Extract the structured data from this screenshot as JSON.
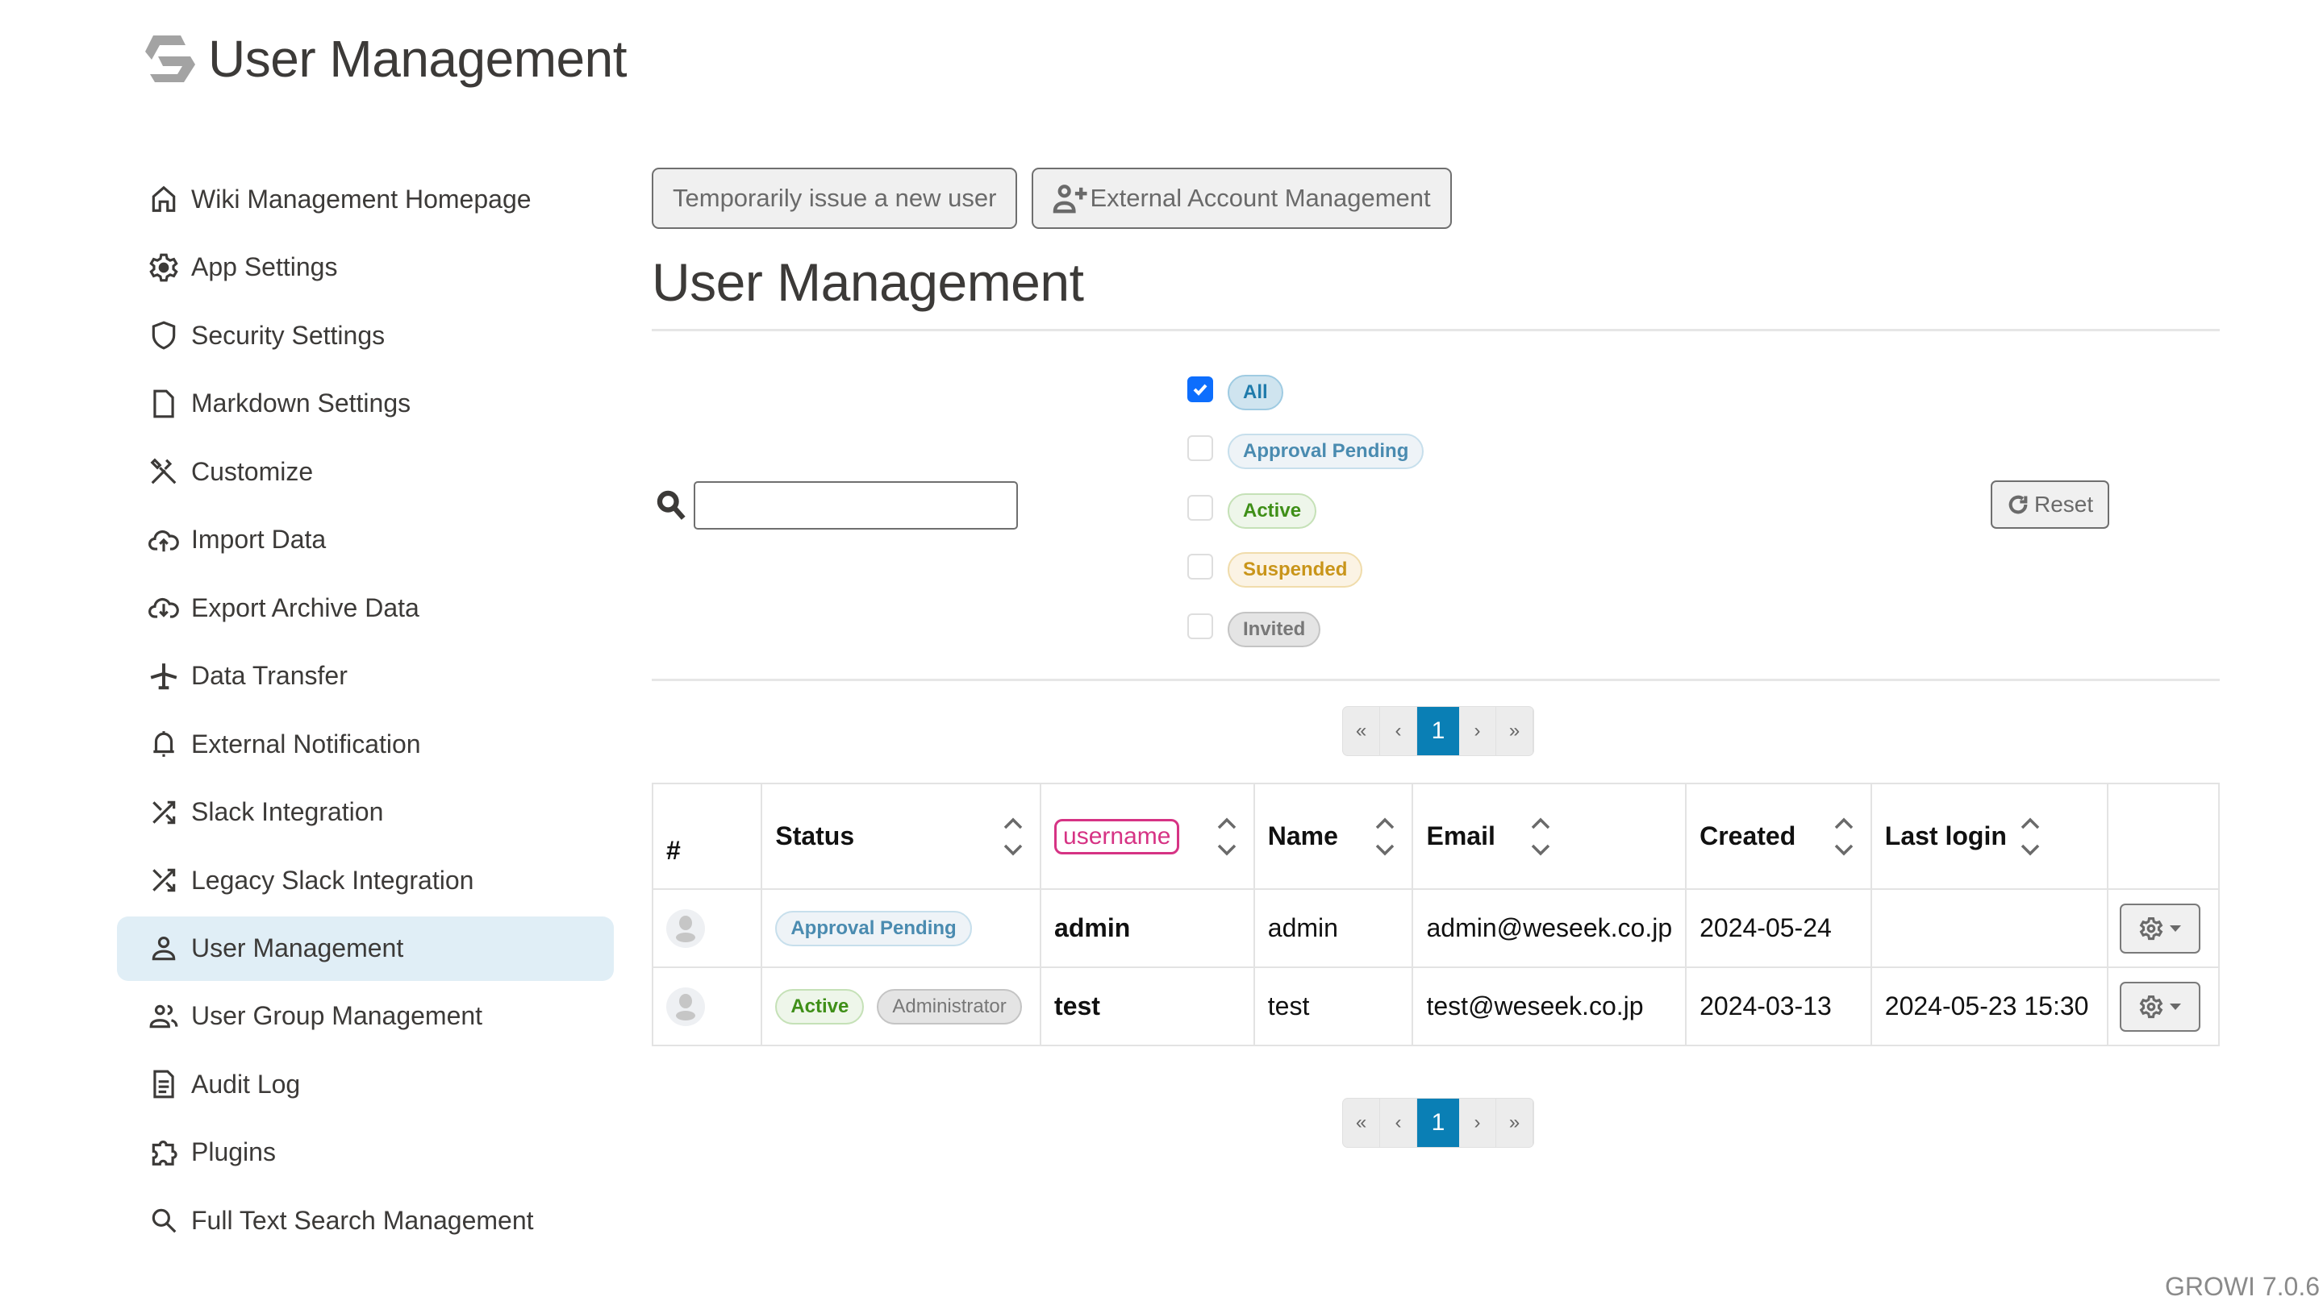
{
  "header": {
    "title": "User Management",
    "logo_icon": "growi-logo"
  },
  "sidebar": {
    "items": [
      {
        "label": "Wiki Management Homepage",
        "icon": "home-icon",
        "active": false
      },
      {
        "label": "App Settings",
        "icon": "gear-icon",
        "active": false
      },
      {
        "label": "Security Settings",
        "icon": "shield-icon",
        "active": false
      },
      {
        "label": "Markdown Settings",
        "icon": "file-icon",
        "active": false
      },
      {
        "label": "Customize",
        "icon": "tools-icon",
        "active": false
      },
      {
        "label": "Import Data",
        "icon": "cloud-upload-icon",
        "active": false
      },
      {
        "label": "Export Archive Data",
        "icon": "cloud-download-icon",
        "active": false
      },
      {
        "label": "Data Transfer",
        "icon": "airplane-icon",
        "active": false
      },
      {
        "label": "External Notification",
        "icon": "bell-icon",
        "active": false
      },
      {
        "label": "Slack Integration",
        "icon": "shuffle-icon",
        "active": false
      },
      {
        "label": "Legacy Slack Integration",
        "icon": "shuffle-icon",
        "active": false
      },
      {
        "label": "User Management",
        "icon": "person-icon",
        "active": true
      },
      {
        "label": "User Group Management",
        "icon": "people-icon",
        "active": false
      },
      {
        "label": "Audit Log",
        "icon": "document-icon",
        "active": false
      },
      {
        "label": "Plugins",
        "icon": "puzzle-icon",
        "active": false
      },
      {
        "label": "Full Text Search Management",
        "icon": "search-icon",
        "active": false
      }
    ]
  },
  "toolbar": {
    "issue_user_label": "Temporarily issue a new user",
    "external_account_label": "External Account Management"
  },
  "main": {
    "title": "User Management",
    "search": {
      "value": "",
      "placeholder": ""
    },
    "filters": [
      {
        "label": "All",
        "checked": true,
        "style": "all"
      },
      {
        "label": "Approval Pending",
        "checked": false,
        "style": "pending"
      },
      {
        "label": "Active",
        "checked": false,
        "style": "active"
      },
      {
        "label": "Suspended",
        "checked": false,
        "style": "suspended"
      },
      {
        "label": "Invited",
        "checked": false,
        "style": "invited"
      }
    ],
    "reset_label": "Reset",
    "pagination": {
      "first": "«",
      "prev": "‹",
      "current": "1",
      "next": "›",
      "last": "»"
    },
    "table": {
      "columns": [
        "#",
        "Status",
        "username",
        "Name",
        "Email",
        "Created",
        "Last login",
        ""
      ],
      "rows": [
        {
          "statuses": [
            {
              "label": "Approval Pending",
              "style": "pending"
            }
          ],
          "username": "admin",
          "name": "admin",
          "email": "admin@weseek.co.jp",
          "created": "2024-05-24",
          "last_login": ""
        },
        {
          "statuses": [
            {
              "label": "Active",
              "style": "active"
            },
            {
              "label": "Administrator",
              "style": "admin"
            }
          ],
          "username": "test",
          "name": "test",
          "email": "test@weseek.co.jp",
          "created": "2024-03-13",
          "last_login": "2024-05-23 15:30"
        }
      ]
    }
  },
  "colors": {
    "accent": "#0a7fb5",
    "active_nav_bg": "#e0eef6",
    "checkbox_checked": "#0d6efd",
    "username_highlight": "#d63384"
  },
  "footer": {
    "version": "GROWI 7.0.6"
  }
}
